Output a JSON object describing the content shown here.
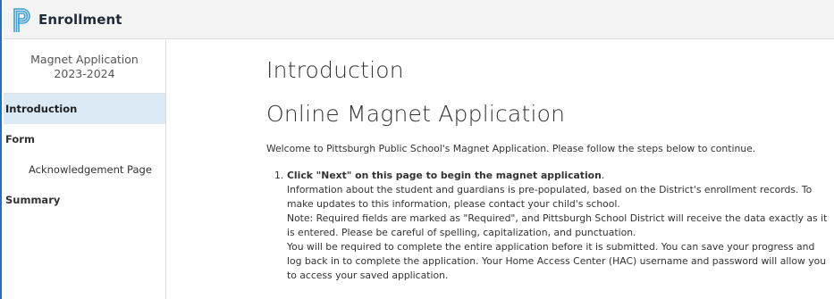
{
  "app": {
    "title": "Enrollment",
    "logo_icon": "powerschool-logo-icon"
  },
  "sidebar": {
    "header": "Magnet Application 2023-2024",
    "items": [
      {
        "label": "Introduction",
        "active": true
      },
      {
        "label": "Form"
      },
      {
        "label": "Acknowledgement Page",
        "sub": true
      },
      {
        "label": "Summary"
      }
    ]
  },
  "main": {
    "title": "Introduction",
    "subtitle": "Online Magnet Application",
    "welcome": "Welcome to Pittsburgh Public School's Magnet Application.  Please follow the steps below to continue.",
    "steps": [
      {
        "number": "1.",
        "heading_bold": "Click \"Next\" on this page to begin the magnet application",
        "heading_tail": ".",
        "lines": [
          "Information about the student and guardians is pre-populated, based on the District's enrollment records. To make updates to this information, please contact your child's school.",
          "Note: Required fields are marked as \"Required\", and Pittsburgh School District will receive the data exactly as it is entered.  Please be careful of spelling, capitalization, and punctuation.",
          "You will be required to complete the entire application before it is submitted. You can save your progress and log back in to complete the application. Your Home Access Center (HAC) username and password will allow you to access your saved application."
        ]
      }
    ]
  },
  "colors": {
    "accent": "#2a6fb3",
    "active_nav_bg": "#dbeaf5",
    "topbar_bg": "#f3f3f3"
  }
}
